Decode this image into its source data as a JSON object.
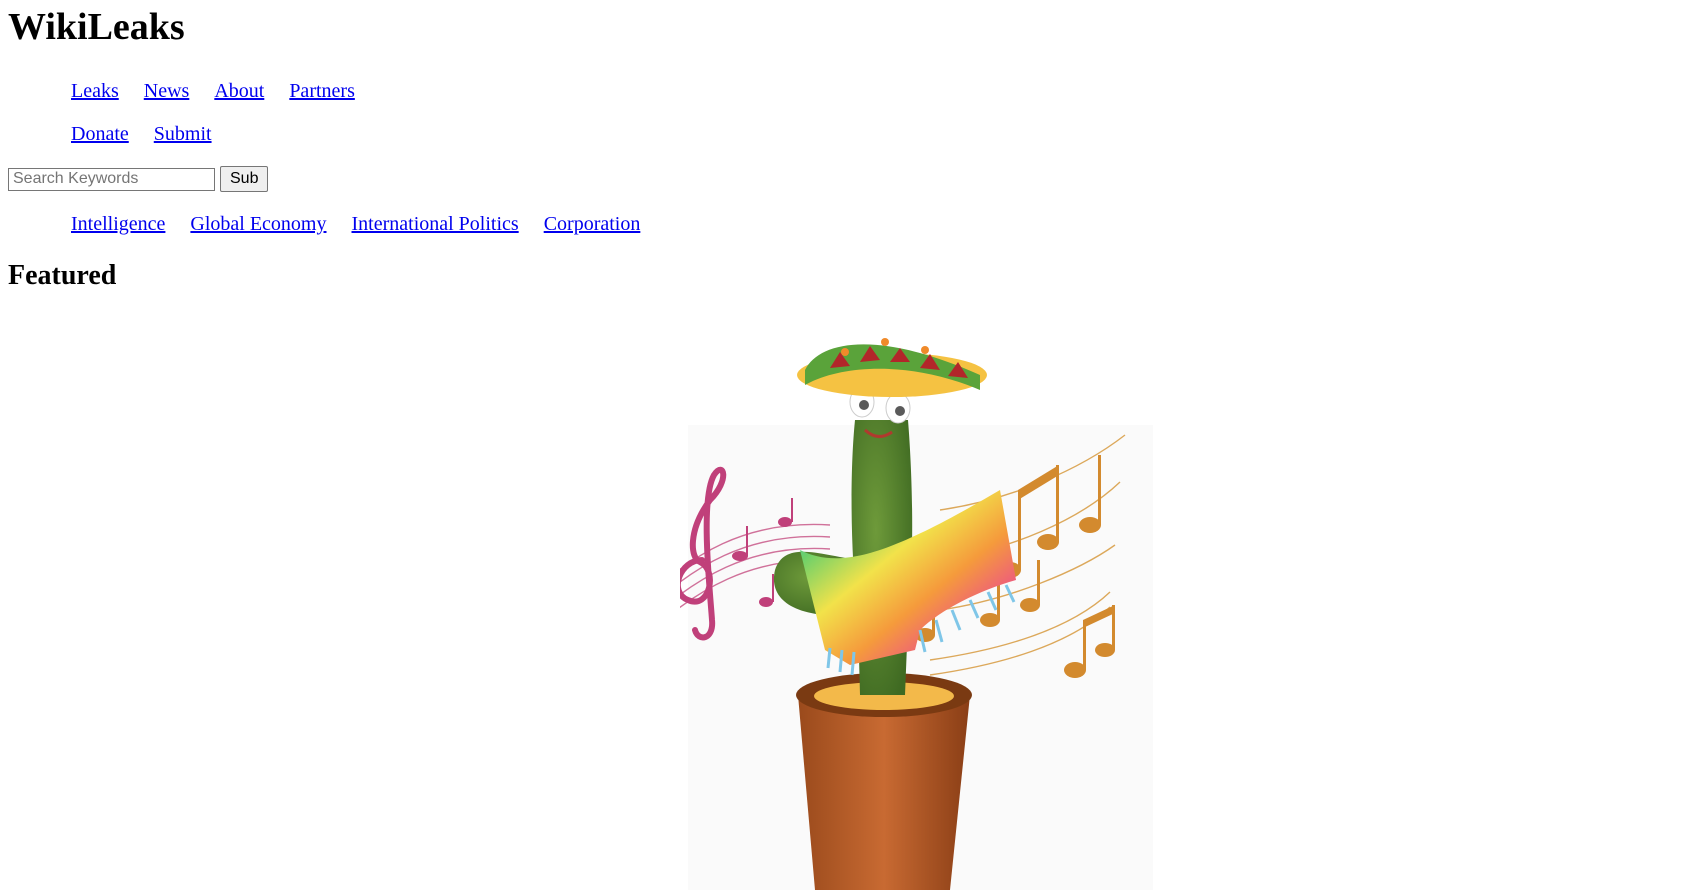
{
  "site": {
    "title": "WikiLeaks"
  },
  "nav_primary": [
    {
      "label": "Leaks"
    },
    {
      "label": "News"
    },
    {
      "label": "About"
    },
    {
      "label": "Partners"
    }
  ],
  "nav_secondary": [
    {
      "label": "Donate"
    },
    {
      "label": "Submit"
    }
  ],
  "search": {
    "placeholder": "Search Keywords",
    "value": "",
    "button_label": "Sub"
  },
  "categories": [
    {
      "label": "Intelligence"
    },
    {
      "label": "Global Economy"
    },
    {
      "label": "International Politics"
    },
    {
      "label": "Corporation"
    }
  ],
  "featured": {
    "heading": "Featured",
    "image_subject": "dancing-cactus-toy-illustration"
  },
  "colors": {
    "link": "#0000ee",
    "text": "#000000",
    "background": "#ffffff"
  }
}
